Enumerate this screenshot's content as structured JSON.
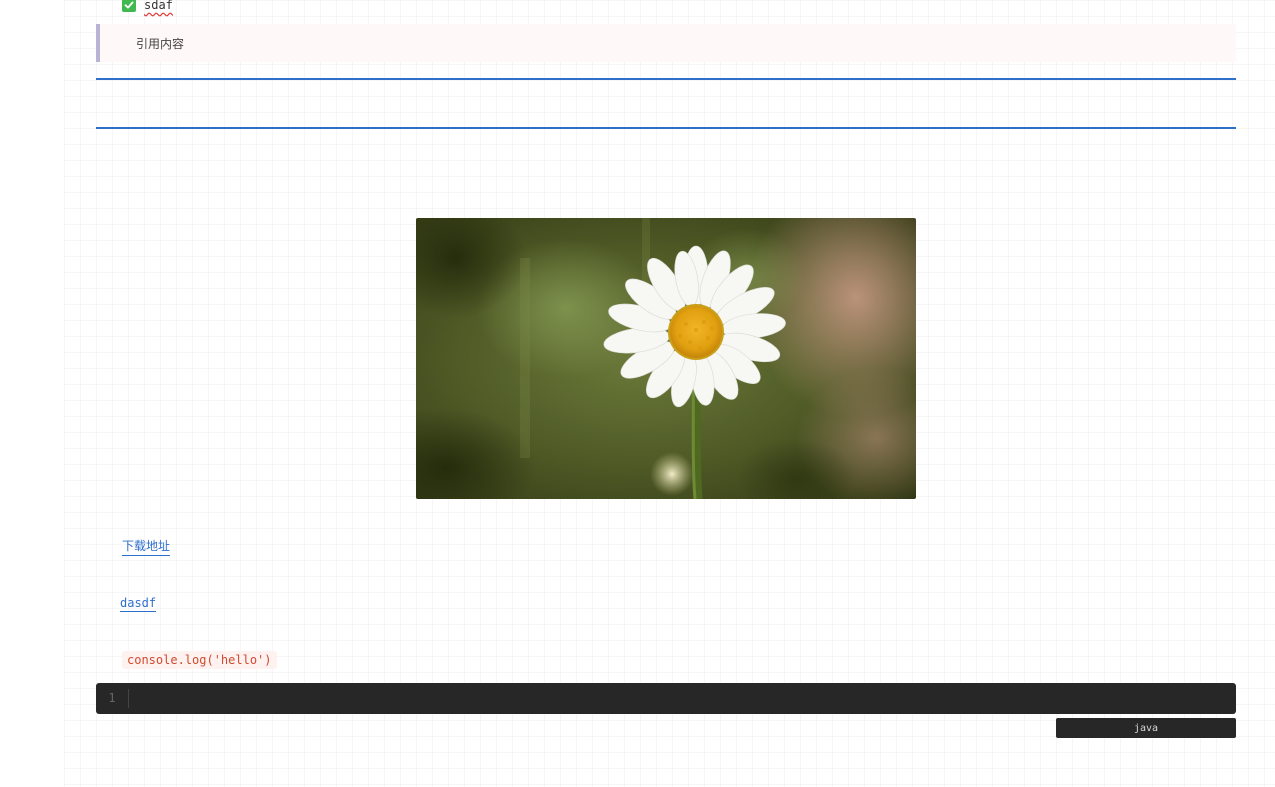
{
  "task": {
    "label": "sdaf",
    "checked": true,
    "icon": "checkbox-checked-icon"
  },
  "quote": {
    "text": "引用内容"
  },
  "image": {
    "alt": "",
    "subject": "white daisy flower on blurred green background"
  },
  "links": {
    "download_label": "下载地址",
    "text_link_label": "dasdf"
  },
  "inline_code": {
    "text": "console.log('hello')"
  },
  "code_block": {
    "line_numbers": [
      "1"
    ],
    "language": "java"
  },
  "colors": {
    "accent": "#2f6fcc",
    "code_bg": "#272727",
    "quote_bar": "#b9b3d6",
    "inline_code": "#d14a2e",
    "check": "#3fb950"
  }
}
